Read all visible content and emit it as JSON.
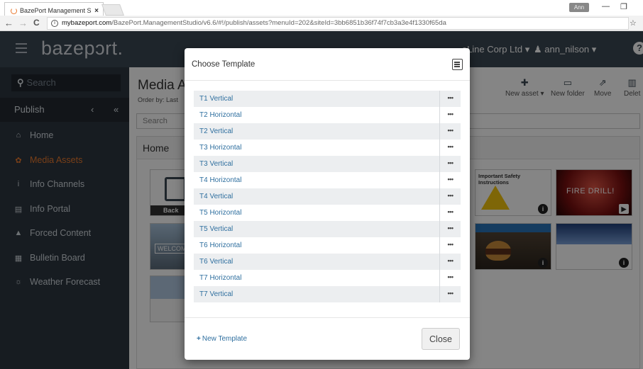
{
  "browser": {
    "tab_title": "BazePort Management S",
    "tab_close": "×",
    "window_user": "Ann",
    "minimize": "—",
    "restore": "❐",
    "back": "←",
    "forward": "→",
    "reload": "C",
    "url_host": "mybazeport.com",
    "url_path": "/BazePort.ManagementStudio/v6.6/#!/publish/assets?menuId=202&siteId=3bb6851b36f74f7cb3a3e4f1330f65da",
    "star": "☆"
  },
  "app": {
    "logo": "bazepɔrt.",
    "company": "...oLine Corp Ltd ▾",
    "user": "♟ ann_nilson ▾",
    "help": "?",
    "sidebar": {
      "search_placeholder": "Search",
      "section": "Publish",
      "collapse": "‹",
      "collapse_all": "«",
      "items": [
        {
          "label": "Home",
          "icon": "home-icon",
          "glyph": "⌂"
        },
        {
          "label": "Media Assets",
          "icon": "media-icon",
          "glyph": "✿"
        },
        {
          "label": "Info Channels",
          "icon": "info-icon",
          "glyph": "i"
        },
        {
          "label": "Info Portal",
          "icon": "portal-icon",
          "glyph": "▤"
        },
        {
          "label": "Forced Content",
          "icon": "warning-icon",
          "glyph": "▲"
        },
        {
          "label": "Bulletin Board",
          "icon": "board-icon",
          "glyph": "▦"
        },
        {
          "label": "Weather Forecast",
          "icon": "weather-icon",
          "glyph": "☼"
        }
      ]
    },
    "content": {
      "title": "Media A",
      "order_by": "Order by: Last",
      "search_placeholder": "Search",
      "breadcrumb": "Home",
      "toolbar": {
        "new_asset": "New asset ▾",
        "new_folder": "New folder",
        "move": "Move",
        "delete": "Delet"
      },
      "thumbs": {
        "safety_title": "Important Safety Instructions",
        "fire": "FIRE DRILL!",
        "backup": "Back",
        "welcome": "WELCOM"
      }
    }
  },
  "modal": {
    "title": "Choose Template",
    "templates": [
      "T1 Vertical",
      "T2 Horizontal",
      "T2 Vertical",
      "T3 Horizontal",
      "T3 Vertical",
      "T4 Horizontal",
      "T4 Vertical",
      "T5 Horizontal",
      "T5 Vertical",
      "T6 Horizontal",
      "T6 Vertical",
      "T7 Horizontal",
      "T7 Vertical"
    ],
    "more_label": "•••",
    "new_template": "New Template",
    "close": "Close"
  },
  "colors": {
    "topnav": "#3b4753",
    "sidebar": "#2d3640",
    "accent": "#e8792e",
    "link": "#2f6f9f"
  }
}
